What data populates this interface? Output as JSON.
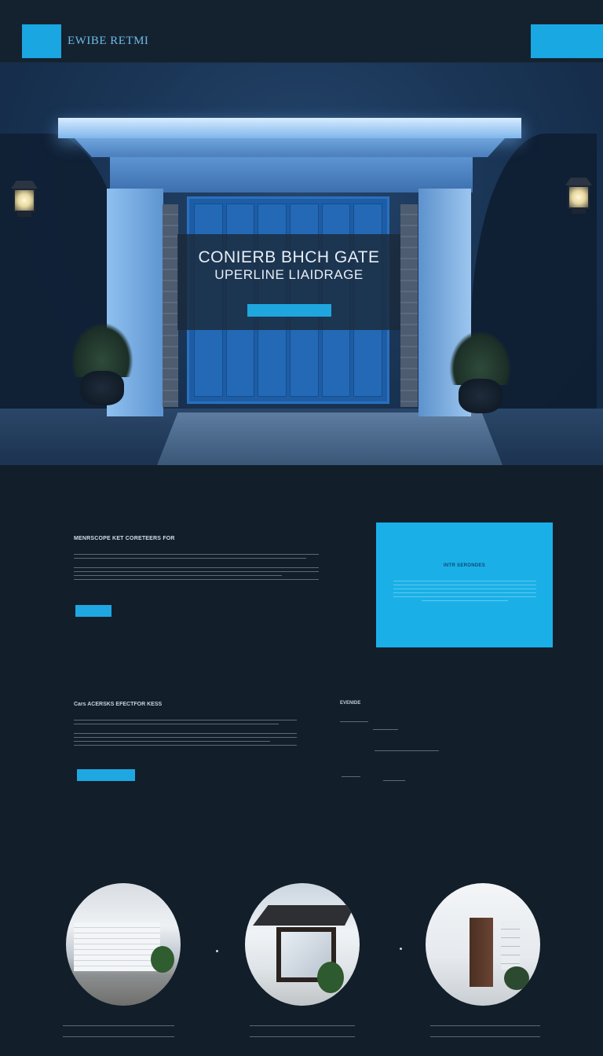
{
  "header": {
    "logo_text": "",
    "brand_name": "EWIBE RETMI",
    "tagline": "",
    "nav": [
      "",
      "",
      "",
      "",
      "",
      "",
      "",
      "",
      ""
    ],
    "cta_label": "",
    "cta_sub": ""
  },
  "hero": {
    "title_line1": "CONIERB BHCH GATE",
    "title_line2": "UPERLINE LIAIDRAGE",
    "button_label": ""
  },
  "section_about": {
    "title": "MENRSCOPE KET CORETEERS FOR",
    "button_label": "",
    "card_title": "INTR SERONDES"
  },
  "section_contact": {
    "title": "Cars ACERSKS EFECTFOR KESS",
    "button_label": "",
    "contact_title": "EVENIDE"
  },
  "gallery": {
    "items": [
      {
        "image": "white-garage-door-house"
      },
      {
        "image": "modern-house-glass-door"
      },
      {
        "image": "white-entry-wood-door"
      }
    ]
  },
  "colors": {
    "accent": "#1aa8e3",
    "background": "#121e2a",
    "hero_door": "#1d5da6"
  }
}
